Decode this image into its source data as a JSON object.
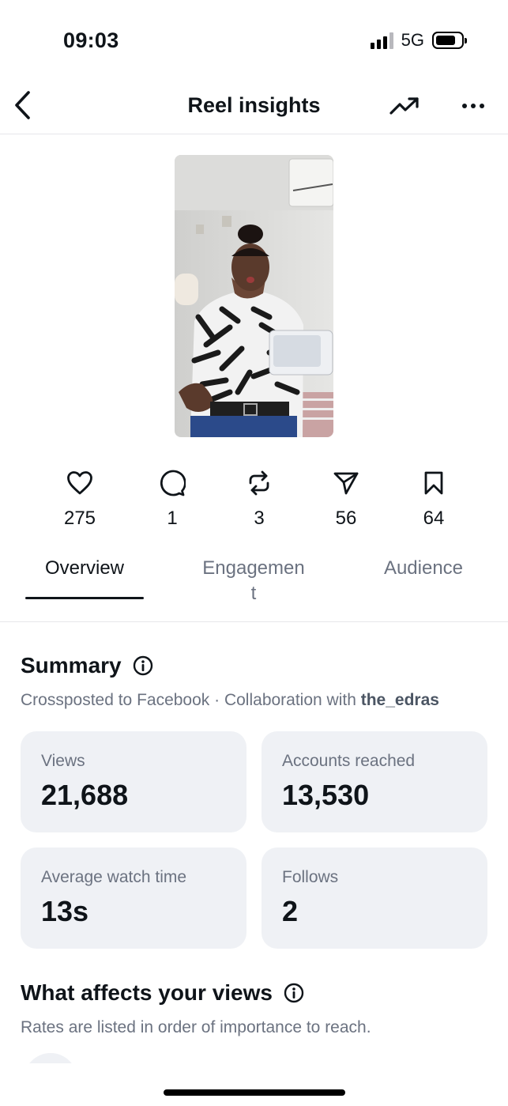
{
  "status_bar": {
    "time": "09:03",
    "network": "5G",
    "signal_bars": 4,
    "signal_active": 3
  },
  "header": {
    "title": "Reel insights",
    "back_icon": "chevron-left-icon",
    "trend_icon": "trending-up-icon",
    "more_icon": "more-horizontal-icon"
  },
  "reel": {
    "thumbnail": "reel-thumbnail"
  },
  "stats": [
    {
      "icon": "heart-icon",
      "value": "275"
    },
    {
      "icon": "comment-icon",
      "value": "1"
    },
    {
      "icon": "repost-icon",
      "value": "3"
    },
    {
      "icon": "share-icon",
      "value": "56"
    },
    {
      "icon": "bookmark-icon",
      "value": "64"
    }
  ],
  "tabs": [
    {
      "label": "Overview",
      "active": true
    },
    {
      "label": "Engagemen\nt",
      "active": false
    },
    {
      "label": "Audience",
      "active": false
    }
  ],
  "summary": {
    "title": "Summary",
    "info_icon": "info-icon",
    "subtitle_prefix": "Crossposted to Facebook · Collaboration with ",
    "collaborator": "the_edras",
    "cards": [
      {
        "label": "Views",
        "value": "21,688"
      },
      {
        "label": "Accounts reached",
        "value": "13,530"
      },
      {
        "label": "Average watch time",
        "value": "13s"
      },
      {
        "label": "Follows",
        "value": "2"
      }
    ]
  },
  "affects": {
    "title": "What affects your views",
    "info_icon": "info-icon",
    "subtitle": "Rates are listed in order of importance to reach."
  },
  "colors": {
    "card_bg": "#eff1f5",
    "text": "#0f1419",
    "muted": "#6b7280",
    "divider": "#e6e7ea"
  }
}
